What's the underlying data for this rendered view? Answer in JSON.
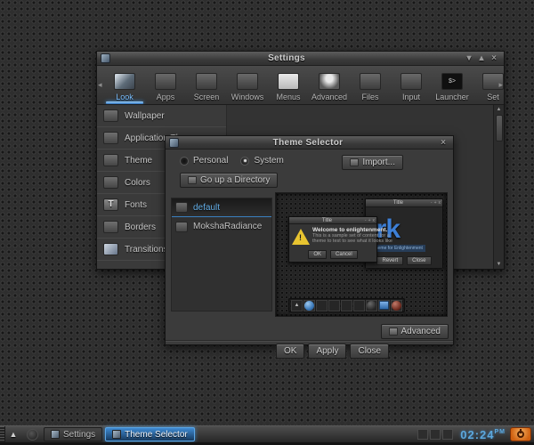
{
  "colors": {
    "accent_blue": "#5fa8e0",
    "selection_blue": "#2a6cb5",
    "warning_yellow": "#e8c430",
    "clock_blue": "#5ca8dd",
    "power_orange": "#e07820",
    "window_bg": "#383838",
    "desktop_bg": "#2e2e2e"
  },
  "icons": {
    "shade": "▾",
    "maximize": "▴",
    "close": "×",
    "left_arrow": "◂",
    "right_arrow": "▸",
    "scroll_up": "▲",
    "scroll_down": "▼",
    "shelf_up": "▲",
    "taskbar_up": "▲",
    "launcher_glyph": "$>",
    "fonts_glyph": "T",
    "mini_shade": "-",
    "mini_max": "+",
    "mini_close": "x",
    "warning_bang": "!"
  },
  "settings_window": {
    "title": "Settings",
    "toolbar": {
      "items": [
        {
          "label": "Look",
          "selected": true
        },
        {
          "label": "Apps"
        },
        {
          "label": "Screen"
        },
        {
          "label": "Windows"
        },
        {
          "label": "Menus"
        },
        {
          "label": "Advanced"
        },
        {
          "label": "Files"
        },
        {
          "label": "Input"
        },
        {
          "label": "Launcher"
        },
        {
          "label": "Set"
        }
      ]
    },
    "sidebar": {
      "items": [
        "Wallpaper",
        "Application Theme",
        "Theme",
        "Colors",
        "Fonts",
        "Borders",
        "Transitions"
      ]
    }
  },
  "theme_dialog": {
    "title": "Theme Selector",
    "radio_personal": "Personal",
    "radio_system": "System",
    "import_button": "Import...",
    "go_up_button": "Go up a Directory",
    "themes": [
      {
        "label": "default",
        "selected": true
      },
      {
        "label": "MokshaRadiance",
        "selected": false
      }
    ],
    "preview": {
      "back_window": {
        "title": "Title",
        "big_text": "ark",
        "caption": "A theme for Enlightenment",
        "button_revert": "Revert",
        "button_close": "Close"
      },
      "front_dialog": {
        "title": "Title",
        "heading": "Welcome to enlightenment.",
        "body_line1": "This is a sample set of content for a",
        "body_line2": "theme to test to see what it looks like",
        "button_ok": "OK",
        "button_cancel": "Cancel"
      }
    },
    "advanced_button": "Advanced",
    "ok_button": "OK",
    "apply_button": "Apply",
    "close_button": "Close"
  },
  "taskbar": {
    "tasks": [
      {
        "label": "Settings",
        "active": false
      },
      {
        "label": "Theme Selector",
        "active": true
      }
    ],
    "clock_time": "02:24",
    "clock_meridiem": "PM"
  }
}
